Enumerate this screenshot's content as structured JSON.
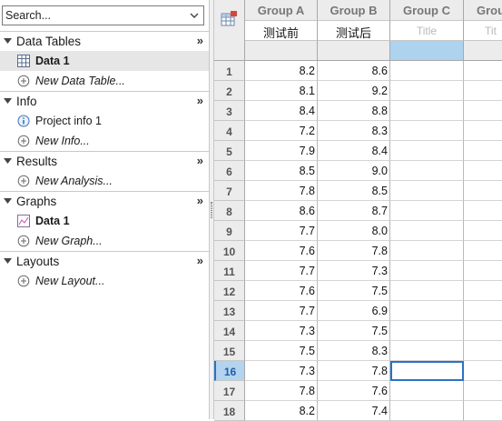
{
  "search": {
    "placeholder": "Search..."
  },
  "nav": {
    "sections": [
      {
        "title": "Data Tables",
        "items": [
          {
            "label": "Data 1",
            "icon": "data-table-icon",
            "bold": true,
            "selected": true
          },
          {
            "label": "New Data Table...",
            "icon": "add-circle-icon",
            "italic": true
          }
        ]
      },
      {
        "title": "Info",
        "items": [
          {
            "label": "Project info 1",
            "icon": "info-icon"
          },
          {
            "label": "New Info...",
            "icon": "add-circle-icon",
            "italic": true
          }
        ]
      },
      {
        "title": "Results",
        "items": [
          {
            "label": "New Analysis...",
            "icon": "add-circle-icon",
            "italic": true
          }
        ]
      },
      {
        "title": "Graphs",
        "items": [
          {
            "label": "Data 1",
            "icon": "graph-icon",
            "bold": true
          },
          {
            "label": "New Graph...",
            "icon": "add-circle-icon",
            "italic": true
          }
        ]
      },
      {
        "title": "Layouts",
        "items": [
          {
            "label": "New Layout...",
            "icon": "add-circle-icon",
            "italic": true
          }
        ]
      }
    ],
    "more_glyph": "»"
  },
  "sheet": {
    "columns": [
      {
        "header": "Group A",
        "title": "测试前",
        "title_placeholder": false
      },
      {
        "header": "Group B",
        "title": "测试后",
        "title_placeholder": false
      },
      {
        "header": "Group C",
        "title": "Title",
        "title_placeholder": true
      },
      {
        "header": "Grou",
        "title": "Tit",
        "title_placeholder": true
      }
    ],
    "rows": [
      {
        "n": "1",
        "a": "8.2",
        "b": "8.6"
      },
      {
        "n": "2",
        "a": "8.1",
        "b": "9.2"
      },
      {
        "n": "3",
        "a": "8.4",
        "b": "8.8"
      },
      {
        "n": "4",
        "a": "7.2",
        "b": "8.3"
      },
      {
        "n": "5",
        "a": "7.9",
        "b": "8.4"
      },
      {
        "n": "6",
        "a": "8.5",
        "b": "9.0"
      },
      {
        "n": "7",
        "a": "7.8",
        "b": "8.5"
      },
      {
        "n": "8",
        "a": "8.6",
        "b": "8.7"
      },
      {
        "n": "9",
        "a": "7.7",
        "b": "8.0"
      },
      {
        "n": "10",
        "a": "7.6",
        "b": "7.8"
      },
      {
        "n": "11",
        "a": "7.7",
        "b": "7.3"
      },
      {
        "n": "12",
        "a": "7.6",
        "b": "7.5"
      },
      {
        "n": "13",
        "a": "7.7",
        "b": "6.9"
      },
      {
        "n": "14",
        "a": "7.3",
        "b": "7.5"
      },
      {
        "n": "15",
        "a": "7.5",
        "b": "8.3"
      },
      {
        "n": "16",
        "a": "7.3",
        "b": "7.8"
      },
      {
        "n": "17",
        "a": "7.8",
        "b": "7.6"
      },
      {
        "n": "18",
        "a": "8.2",
        "b": "7.4"
      }
    ],
    "active_row": "16",
    "colors": {
      "selection": "#2a72c4",
      "highlight": "#aed3ef"
    }
  }
}
